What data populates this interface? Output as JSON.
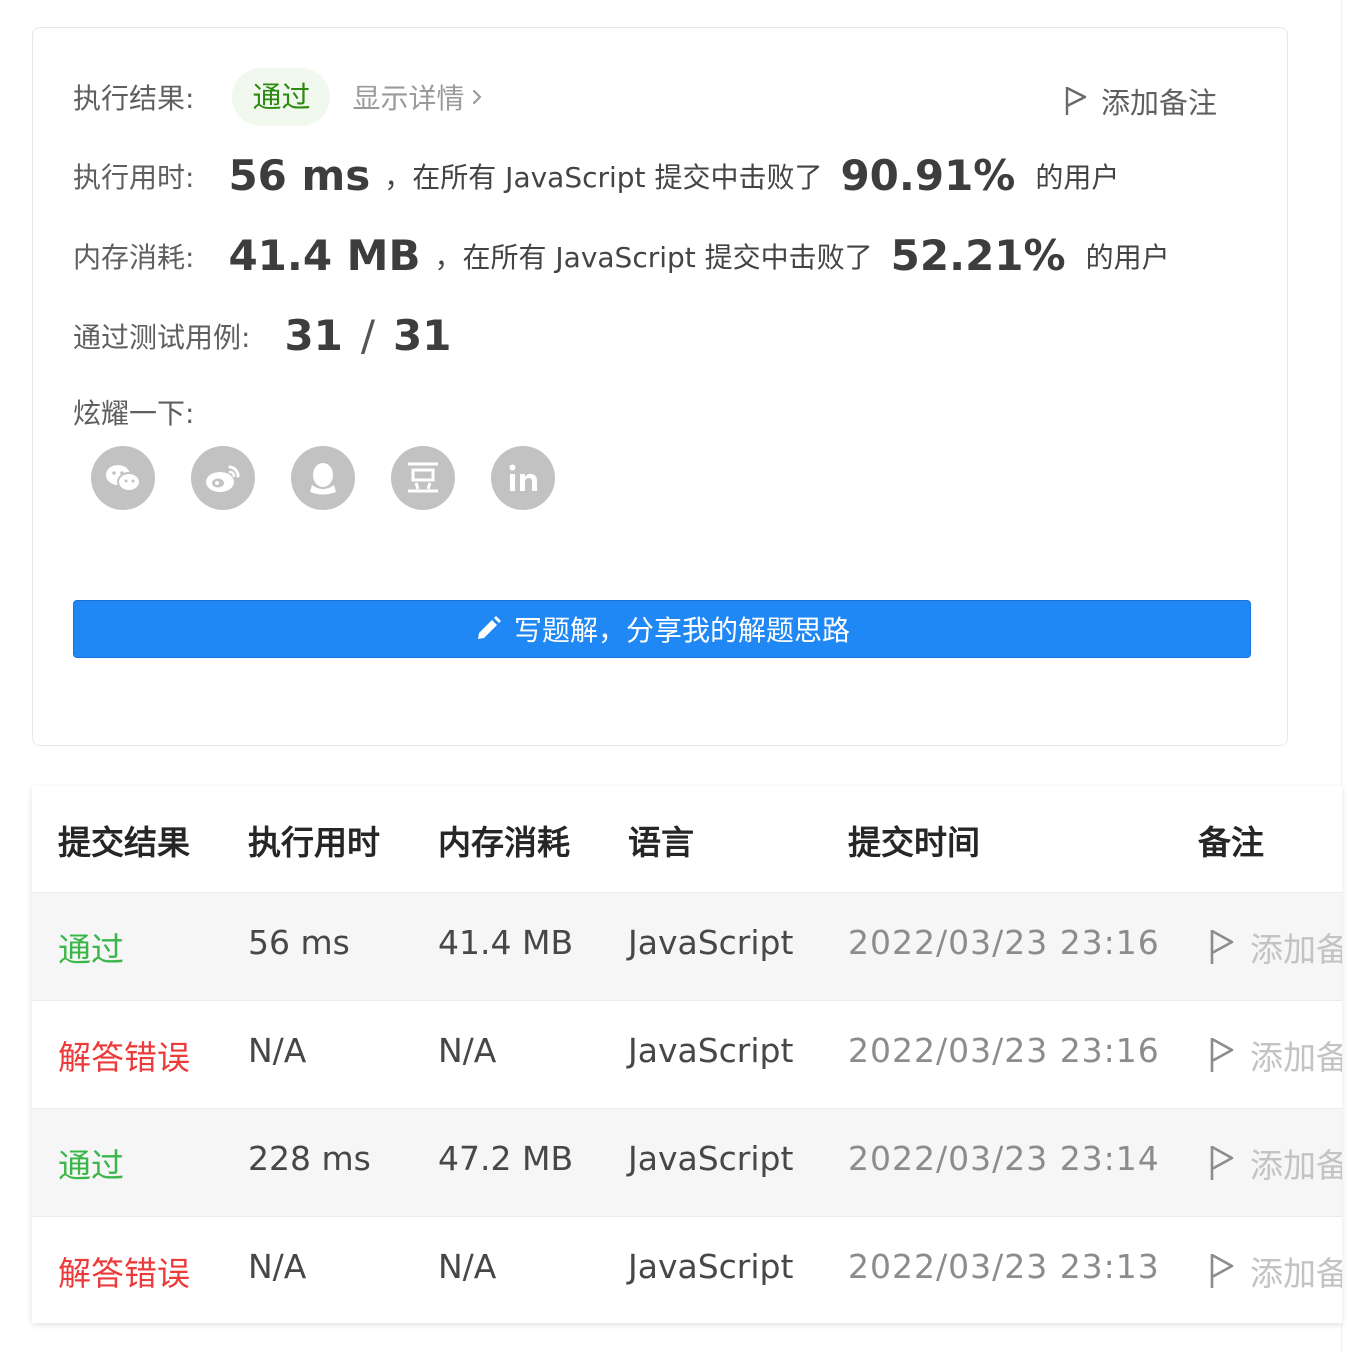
{
  "result": {
    "status_label": "执行结果:",
    "status_badge": "通过",
    "detail_link": "显示详情",
    "add_note": "添加备注",
    "runtime": {
      "label": "执行用时:",
      "value": "56 ms",
      "text_before": "，在所有 JavaScript 提交中击败了",
      "percent": "90.91%",
      "text_after": "的用户"
    },
    "memory": {
      "label": "内存消耗:",
      "value": "41.4 MB",
      "text_before": "，在所有 JavaScript 提交中击败了",
      "percent": "52.21%",
      "text_after": "的用户"
    },
    "testcases": {
      "label": "通过测试用例:",
      "passed": "31",
      "separator": "/",
      "total": "31"
    },
    "share": {
      "label": "炫耀一下:",
      "icons": [
        "wechat-icon",
        "weibo-icon",
        "qq-icon",
        "douban-icon",
        "linkedin-icon"
      ]
    },
    "write_solution_button": "写题解，分享我的解题思路"
  },
  "submissions": {
    "columns": [
      "提交结果",
      "执行用时",
      "内存消耗",
      "语言",
      "提交时间",
      "备注"
    ],
    "rows": [
      {
        "status": "通过",
        "status_type": "pass",
        "runtime": "56 ms",
        "memory": "41.4 MB",
        "language": "JavaScript",
        "time": "2022/03/23 23:16",
        "note": "添加备注"
      },
      {
        "status": "解答错误",
        "status_type": "fail",
        "runtime": "N/A",
        "memory": "N/A",
        "language": "JavaScript",
        "time": "2022/03/23 23:16",
        "note": "添加备注"
      },
      {
        "status": "通过",
        "status_type": "pass",
        "runtime": "228 ms",
        "memory": "47.2 MB",
        "language": "JavaScript",
        "time": "2022/03/23 23:14",
        "note": "添加备注"
      },
      {
        "status": "解答错误",
        "status_type": "fail",
        "runtime": "N/A",
        "memory": "N/A",
        "language": "JavaScript",
        "time": "2022/03/23 23:13",
        "note": "添加备注"
      }
    ]
  },
  "colors": {
    "pass": "#3cb64a",
    "fail": "#ec3b3b",
    "primary_button": "#1f88f5",
    "badge_bg": "#f1f8ee"
  }
}
